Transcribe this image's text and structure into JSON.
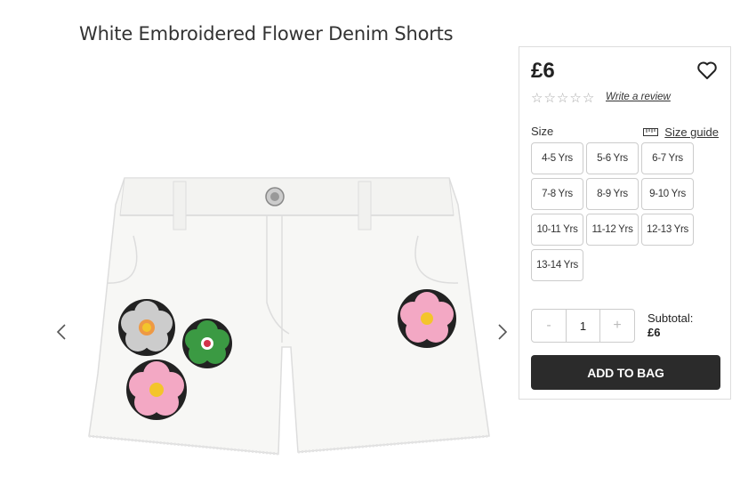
{
  "product": {
    "title": "White Embroidered Flower Denim Shorts",
    "price": "£6",
    "review_link": "Write a review",
    "rating": 0,
    "rating_max": 5
  },
  "size": {
    "label": "Size",
    "guide_label": "Size guide",
    "options": [
      "4-5 Yrs",
      "5-6 Yrs",
      "6-7 Yrs",
      "7-8 Yrs",
      "8-9 Yrs",
      "9-10 Yrs",
      "10-11 Yrs",
      "11-12 Yrs",
      "12-13 Yrs",
      "13-14 Yrs"
    ]
  },
  "quantity": {
    "minus": "-",
    "value": "1",
    "plus": "+"
  },
  "subtotal": {
    "label": "Subtotal:",
    "amount": "£6"
  },
  "actions": {
    "add_to_bag": "ADD TO BAG"
  },
  "icons": {
    "wishlist": "heart-icon",
    "size_guide": "ruler-icon",
    "prev": "chevron-left-icon",
    "next": "chevron-right-icon",
    "star": "star-outline-icon"
  }
}
